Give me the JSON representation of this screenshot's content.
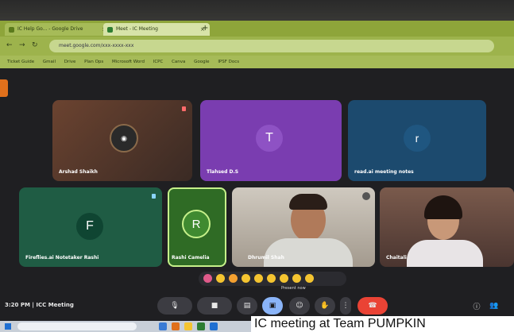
{
  "browser": {
    "tabs": [
      {
        "label": "IC Help Go... - Google Drive"
      },
      {
        "label": "Meet - IC Meeting"
      }
    ],
    "address": "meet.google.com/xxx-xxxx-xxx",
    "bookmarks": [
      "Ticket Guide",
      "Gmail",
      "Drive",
      "Plan Ops",
      "Microsoft Word",
      "ICPC",
      "Canva",
      "Google",
      "IPSF Docs"
    ]
  },
  "participants": [
    {
      "name": "Arshad Shaikh",
      "bg": "#5a3a2a"
    },
    {
      "name": "Tlahsed D.S",
      "initial": "T",
      "bg": "#7a3db0",
      "avatar_color": "#8e52c4"
    },
    {
      "name": "read.ai meeting notes",
      "initial": "r",
      "bg": "#1c4a6e",
      "avatar_color": "#1f5680"
    },
    {
      "name": "Fireflies.ai Notetaker Rashi",
      "initial": "F",
      "bg": "#1f5c44",
      "avatar_color": "#0f4532"
    },
    {
      "name": "Rashi Camelia",
      "initial": "R",
      "bg": "#2f6b25",
      "avatar_color": "#3f8a30"
    },
    {
      "name": "Dhrumil Shah",
      "bg": "#b7b0a6"
    },
    {
      "name": "Chaitali",
      "bg": "#6b4a3e"
    }
  ],
  "meeting": {
    "info": "3:20 PM  |  ICC Meeting",
    "present_tooltip": "Present now"
  },
  "colors": {
    "accent": "#8ab4f8",
    "end_call": "#ea4335"
  },
  "caption": "IC meeting at Team PUMPKIN"
}
